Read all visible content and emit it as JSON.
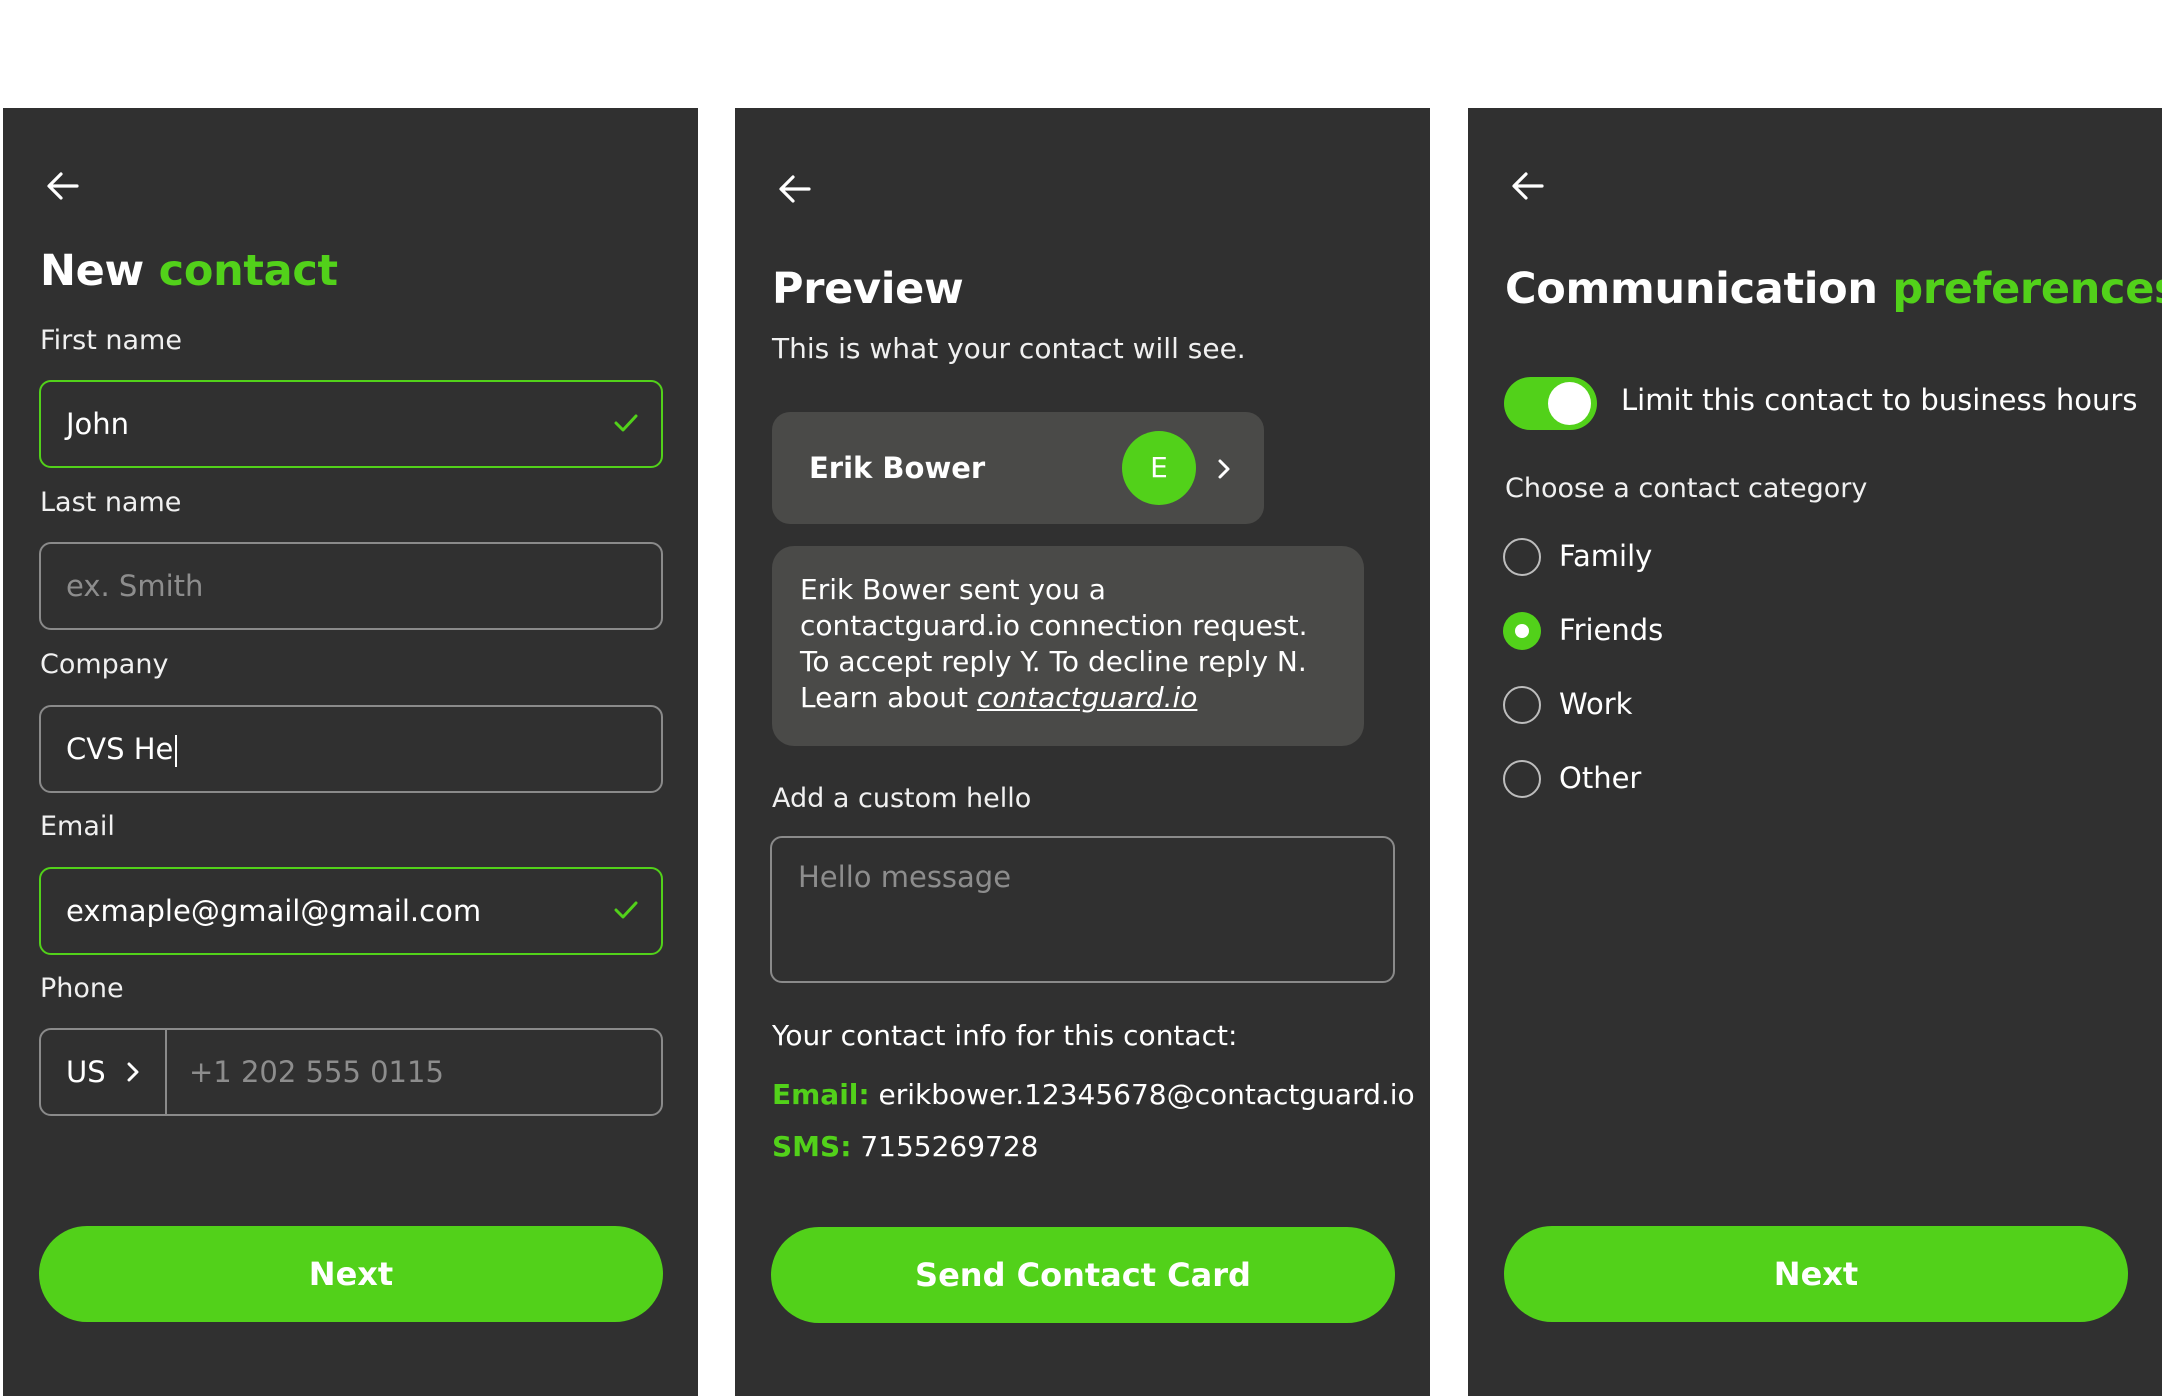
{
  "colors": {
    "accent": "#52d11a",
    "panel": "#303030",
    "card": "#4a4a48",
    "border": "#8a8a8a"
  },
  "screen1": {
    "back_icon": "arrow-left-icon",
    "title_prefix": "New",
    "title_accent": "contact",
    "first_name": {
      "label": "First name",
      "value": "John",
      "valid": true
    },
    "last_name": {
      "label": "Last name",
      "placeholder": "ex. Smith"
    },
    "company": {
      "label": "Company",
      "value": "CVS He"
    },
    "email": {
      "label": "Email",
      "value": "exmaple@gmail@gmail.com",
      "valid": true
    },
    "phone": {
      "label": "Phone",
      "country": "US",
      "placeholder": "+1 202 555 0115"
    },
    "next_label": "Next"
  },
  "screen2": {
    "back_icon": "arrow-left-icon",
    "title": "Preview",
    "subtitle": "This is what your contact will see.",
    "card": {
      "name": "Erik Bower",
      "avatar_letter": "E"
    },
    "bubble": {
      "line1": "Erik Bower sent you a",
      "line2": "contactguard.io connection request.",
      "line3": "To accept reply Y. To decline reply N.",
      "line4_prefix": "Learn about",
      "link": "contactguard.io"
    },
    "hello_label": "Add a custom hello",
    "hello_placeholder": "Hello message",
    "info_heading": "Your contact info for this contact:",
    "email_key": "Email:",
    "email_value": "erikbower.12345678@contactguard.io",
    "sms_key": "SMS:",
    "sms_value": "7155269728",
    "send_label": "Send Contact Card"
  },
  "screen3": {
    "back_icon": "arrow-left-icon",
    "title_prefix": "Communication",
    "title_accent": "preferences",
    "toggle": {
      "label": "Limit this contact to business hours",
      "on": true
    },
    "category_label": "Choose a contact category",
    "categories": [
      {
        "label": "Family",
        "selected": false
      },
      {
        "label": "Friends",
        "selected": true
      },
      {
        "label": "Work",
        "selected": false
      },
      {
        "label": "Other",
        "selected": false
      }
    ],
    "next_label": "Next"
  }
}
